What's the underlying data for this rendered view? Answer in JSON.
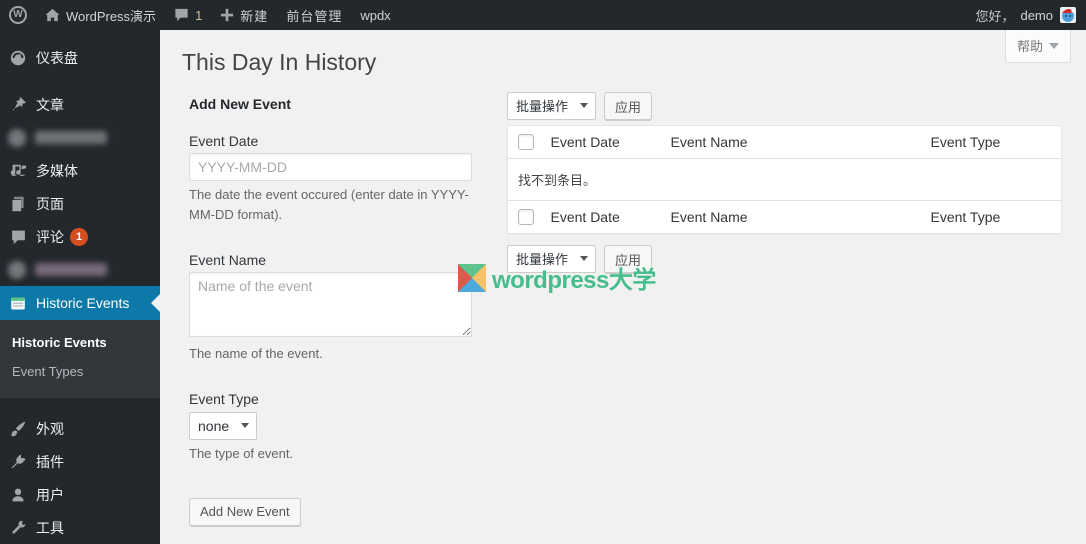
{
  "admin_bar": {
    "logo_letter": "W",
    "site_name": "WordPress演示",
    "comment_count": "1",
    "new_label": "新建",
    "front_manage_label": "前台管理",
    "wpdx_label": "wpdx",
    "greeting": "您好，",
    "username": "demo"
  },
  "help": {
    "label": "帮助"
  },
  "sidebar": {
    "items": [
      {
        "label": "仪表盘",
        "icon": "dashboard-icon"
      },
      {
        "label": "文章",
        "icon": "pin-icon"
      },
      {
        "label": "",
        "redacted": true
      },
      {
        "label": "多媒体",
        "icon": "media-icon"
      },
      {
        "label": "页面",
        "icon": "pages-icon"
      },
      {
        "label": "评论",
        "icon": "comments-icon",
        "badge": "1"
      },
      {
        "label": "",
        "redacted": true
      },
      {
        "label": "Historic Events",
        "icon": "calendar-icon",
        "active": true
      },
      {
        "label": "外观",
        "icon": "appearance-icon"
      },
      {
        "label": "插件",
        "icon": "plugins-icon"
      },
      {
        "label": "用户",
        "icon": "users-icon"
      },
      {
        "label": "工具",
        "icon": "tools-icon"
      }
    ],
    "submenu": {
      "items": [
        {
          "label": "Historic Events",
          "current": true
        },
        {
          "label": "Event Types",
          "current": false
        }
      ]
    }
  },
  "page": {
    "title": "This Day In History"
  },
  "form": {
    "heading": "Add New Event",
    "fields": [
      {
        "label": "Event Date",
        "placeholder": "YYYY-MM-DD",
        "description": "The date the event occured (enter date in YYYY-MM-DD format)."
      },
      {
        "label": "Event Name",
        "placeholder": "Name of the event",
        "description": "The name of the event."
      },
      {
        "label": "Event Type",
        "selected_option": "none",
        "description": "The type of event."
      }
    ],
    "submit_label": "Add New Event"
  },
  "list": {
    "bulk_action_label": "批量操作",
    "apply_label": "应用",
    "columns": [
      "Event Date",
      "Event Name",
      "Event Type"
    ],
    "empty_message": "找不到条目。"
  },
  "watermark": {
    "text": "wordpress大学"
  },
  "colors": {
    "accent_blue": "#0c79a9",
    "badge_red": "#d54e21",
    "watermark_green": "#45be8c",
    "admin_bar_bg": "#23282d",
    "content_bg": "#f1f1f1"
  }
}
